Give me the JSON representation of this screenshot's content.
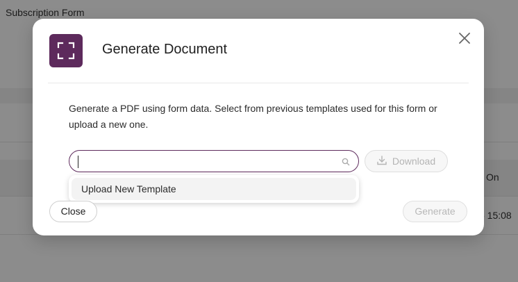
{
  "background": {
    "page_title": "Subscription Form",
    "column_header_partial": "On",
    "cell_time_partial": "6 15:08"
  },
  "modal": {
    "title": "Generate Document",
    "description": "Generate a PDF using form data. Select from previous templates used for this form or upload a new one.",
    "search": {
      "value": "",
      "placeholder": ""
    },
    "download_label": "Download",
    "dropdown_options": [
      "Upload New Template"
    ],
    "close_label": "Close",
    "generate_label": "Generate",
    "icons": {
      "header": "expand-icon",
      "close": "close-icon",
      "search": "search-icon",
      "download": "download-icon"
    }
  },
  "colors": {
    "accent": "#5d2a5c",
    "overlay": "#8c8c8c",
    "disabled_text": "#b4b4b4"
  }
}
